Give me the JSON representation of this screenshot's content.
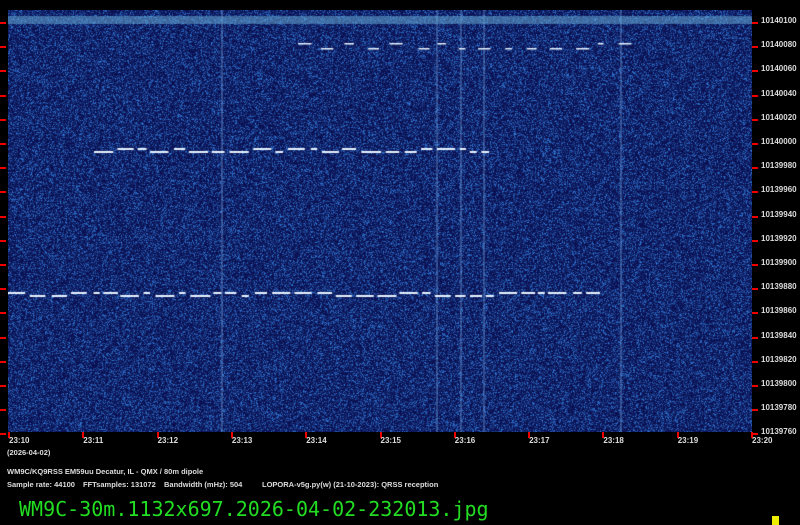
{
  "freq_labels": [
    "10140100",
    "10140080",
    "10140060",
    "10140040",
    "10140020",
    "10140000",
    "10139980",
    "10139960",
    "10139940",
    "10139920",
    "10139900",
    "10139880",
    "10139860",
    "10139840",
    "10139820",
    "10139800",
    "10139780",
    "10139760"
  ],
  "time_labels": [
    "23:10",
    "23:11",
    "23:12",
    "23:13",
    "23:14",
    "23:15",
    "23:16",
    "23:17",
    "23:18",
    "23:19",
    "23:20"
  ],
  "date_label": "(2026-04-02)",
  "station_line": "WM9C/KQ9RSS EM59uu Decatur, IL - QMX / 80m dipole",
  "params": {
    "sample_rate": "Sample rate: 44100",
    "fft": "FFTsamples: 131072",
    "bandwidth": "Bandwidth (mHz): 504",
    "software": "LOPORA-v5g.py(w) (21-10-2023): QRSS reception"
  },
  "filename": "WM9C-30m.1132x697.2026-04-02-232013.jpg",
  "colors": {
    "background": "#0a0f5a",
    "signal": "#e8f4ff",
    "tick": "#ee0000",
    "filename": "#22dd22"
  }
}
